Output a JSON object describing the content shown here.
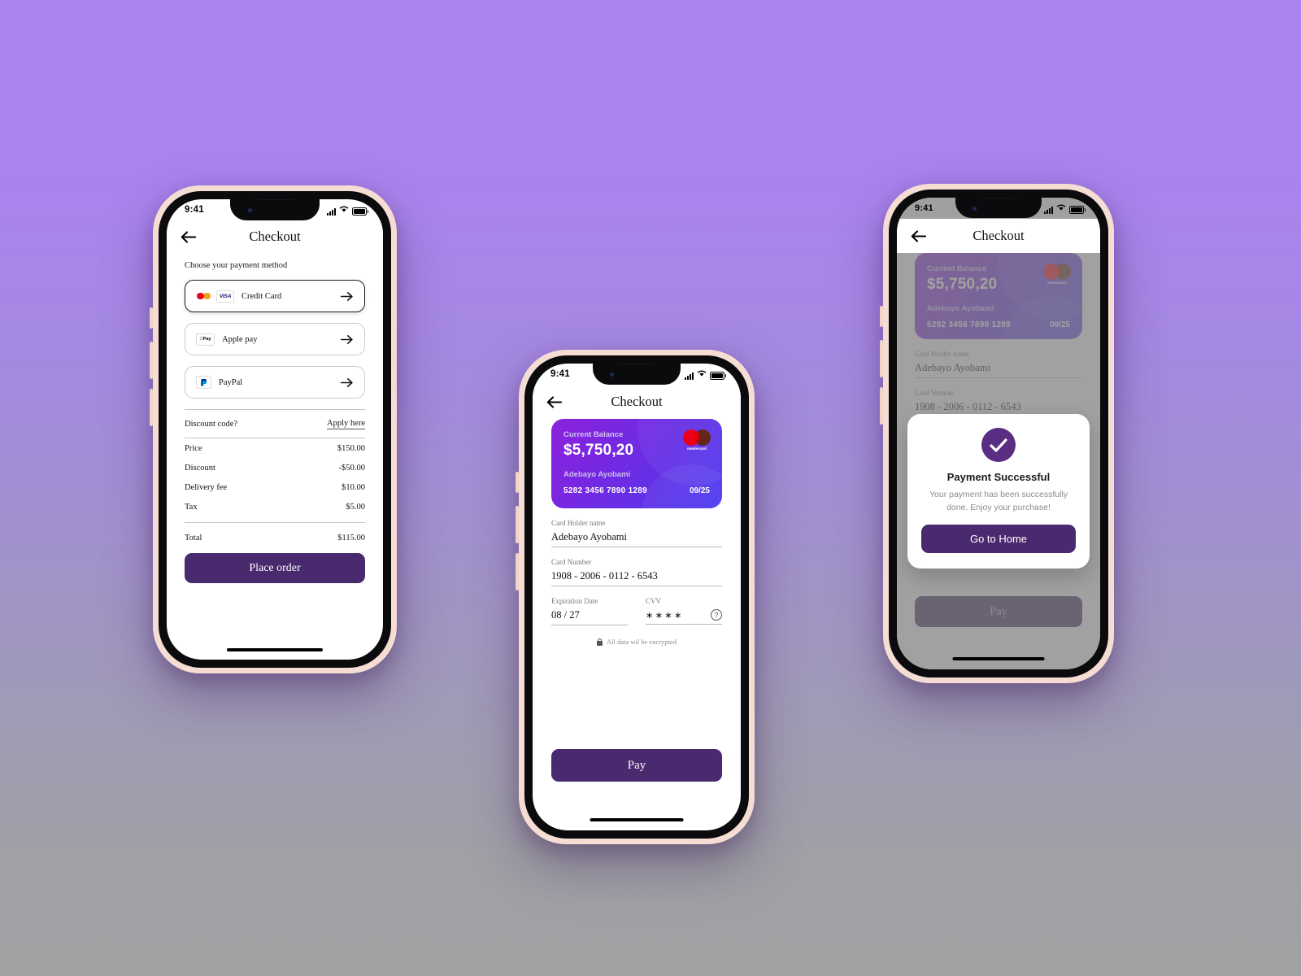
{
  "background": {
    "top_color": "#a984ef",
    "bottom_color": "#a0a0a6"
  },
  "theme": {
    "primary": "#4a2a6e",
    "card_gradient_start": "#8b23dd",
    "card_gradient_end": "#4b3cf0",
    "success": "#5b2d82"
  },
  "status_bar": {
    "time": "9:41",
    "signal_icon": "cellular-bars-icon",
    "wifi_icon": "wifi-icon",
    "battery_icon": "battery-icon"
  },
  "phone1": {
    "nav": {
      "title": "Checkout",
      "back_icon": "arrow-left-icon"
    },
    "section_label": "Choose your payment method",
    "payment_methods": [
      {
        "label": "Credit Card",
        "selected": true,
        "icons": [
          "mastercard-icon",
          "visa-icon"
        ],
        "chevron": "arrow-right-icon"
      },
      {
        "label": "Apple pay",
        "selected": false,
        "icons": [
          "apple-pay-icon"
        ],
        "chevron": "arrow-right-icon"
      },
      {
        "label": "PayPal",
        "selected": false,
        "icons": [
          "paypal-icon"
        ],
        "chevron": "arrow-right-icon"
      }
    ],
    "discount": {
      "question": "Discount code?",
      "action": "Apply here"
    },
    "summary": [
      {
        "label": "Price",
        "value": "$150.00"
      },
      {
        "label": "Discount",
        "value": "-$50.00"
      },
      {
        "label": "Delivery fee",
        "value": "$10.00"
      },
      {
        "label": "Tax",
        "value": "$5.00"
      }
    ],
    "total": {
      "label": "Total",
      "value": "$115.00"
    },
    "cta": "Place order"
  },
  "phone2": {
    "nav": {
      "title": "Checkout",
      "back_icon": "arrow-left-icon"
    },
    "card": {
      "balance_label": "Current Balance",
      "balance_amount": "$5,750,20",
      "holder": "Adebayo Ayobami",
      "number": "5282 3456 7890 1289",
      "expiry": "09/25",
      "brand": "mastercard",
      "brand_text": "mastercard"
    },
    "form": {
      "holder_label": "Card Holder name",
      "holder_value": "Adebayo Ayobami",
      "number_label": "Card Number",
      "number_value": "1908 - 2006 - 0112 - 6543",
      "expiry_label": "Expiration Date",
      "expiry_value": "08 / 27",
      "cvv_label": "CVV",
      "cvv_value": "∗∗∗∗",
      "cvv_help_icon": "question-circle-icon"
    },
    "encryption_note": "All data wil be encrypted",
    "lock_icon": "lock-icon",
    "cta": "Pay"
  },
  "phone3": {
    "nav": {
      "title": "Checkout",
      "back_icon": "arrow-left-icon"
    },
    "card": {
      "balance_label": "Current Balance",
      "balance_amount": "$5,750,20",
      "holder": "Adebayo Ayobami",
      "number": "5282 3456 7890 1289",
      "expiry": "09/25",
      "brand_text": "mastercard"
    },
    "modal": {
      "check_icon": "checkmark-icon",
      "title": "Payment Successful",
      "message": "Your payment has been successfully done. Enjoy your purchase!",
      "button": "Go to Home"
    },
    "cta": "Pay"
  }
}
